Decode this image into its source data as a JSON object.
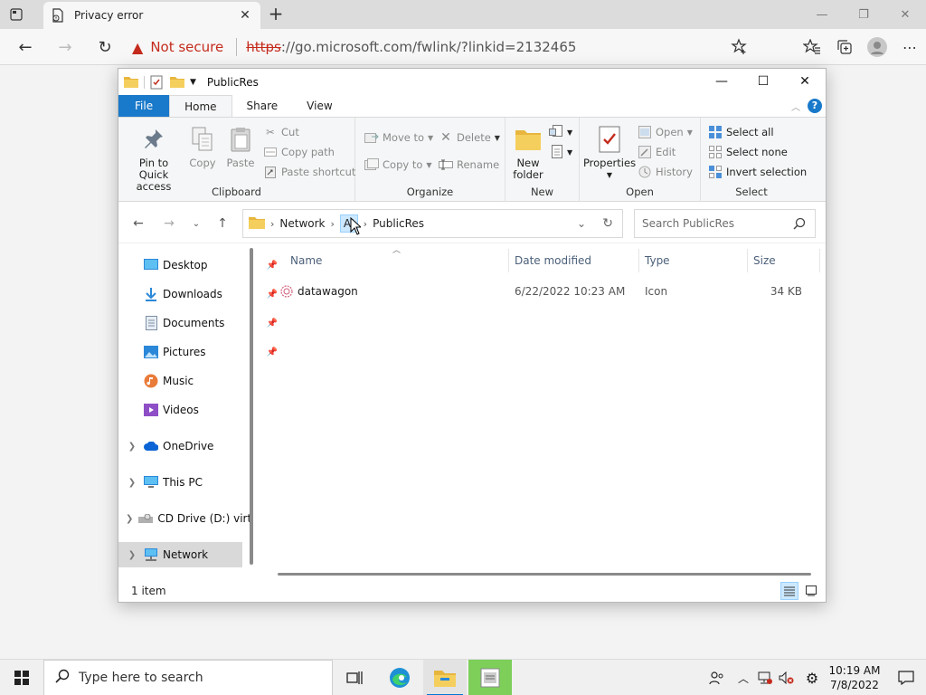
{
  "browser": {
    "tab_title": "Privacy error",
    "security_label": "Not secure",
    "url_scheme": "https",
    "url_rest": "://go.microsoft.com/fwlink/?linkid=2132465"
  },
  "explorer": {
    "window_title": "PublicRes",
    "ribbon_tabs": [
      "File",
      "Home",
      "Share",
      "View"
    ],
    "clipboard": {
      "pin_label_1": "Pin to Quick",
      "pin_label_2": "access",
      "copy": "Copy",
      "paste": "Paste",
      "cut": "Cut",
      "copy_path": "Copy path",
      "paste_shortcut": "Paste shortcut",
      "group": "Clipboard"
    },
    "organize": {
      "move_to": "Move to",
      "copy_to": "Copy to",
      "delete": "Delete",
      "rename": "Rename",
      "group": "Organize"
    },
    "new": {
      "new_folder_1": "New",
      "new_folder_2": "folder",
      "group": "New"
    },
    "open": {
      "properties": "Properties",
      "open": "Open",
      "edit": "Edit",
      "history": "History",
      "group": "Open"
    },
    "select": {
      "select_all": "Select all",
      "select_none": "Select none",
      "invert": "Invert selection",
      "group": "Select"
    },
    "address": {
      "crumb_1": "Network",
      "crumb_2": "AJ",
      "crumb_3": "PublicRes",
      "search_placeholder": "Search PublicRes"
    },
    "nav_items": [
      "Desktop",
      "Downloads",
      "Documents",
      "Pictures",
      "Music",
      "Videos",
      "OneDrive",
      "This PC",
      "CD Drive (D:) virt",
      "Network"
    ],
    "columns": [
      "Name",
      "Date modified",
      "Type",
      "Size"
    ],
    "files": [
      {
        "name": "datawagon",
        "date": "6/22/2022 10:23 AM",
        "type": "Icon",
        "size": "34 KB"
      }
    ],
    "status_text": "1 item"
  },
  "taskbar": {
    "search_placeholder": "Type here to search",
    "time": "10:19 AM",
    "date": "7/8/2022"
  }
}
